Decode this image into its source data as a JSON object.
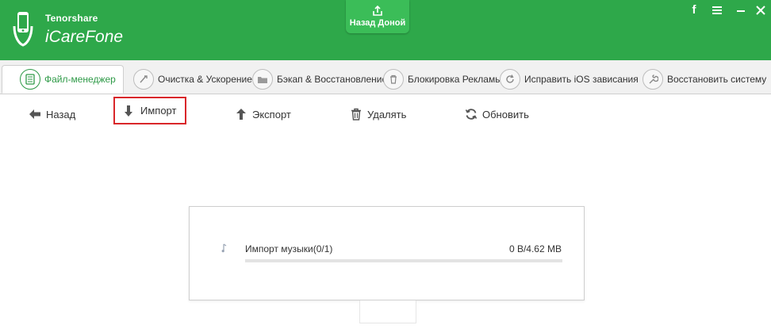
{
  "app": {
    "brand_small": "Tenorshare",
    "brand_name": "iCareFone",
    "home_button_label": "Назад Доной",
    "window_controls": [
      "facebook-icon",
      "menu-icon",
      "minimize-icon",
      "close-icon"
    ],
    "accent_color": "#2ea84a",
    "selected_outline_color": "#d9262a"
  },
  "tabs": [
    {
      "label": "Файл-менеджер",
      "icon": "file-manager-icon",
      "active": true
    },
    {
      "label": "Очистка & Ускорение",
      "icon": "rocket-icon",
      "active": false
    },
    {
      "label": "Бэкап & Восстановление",
      "icon": "folder-icon",
      "active": false
    },
    {
      "label": "Блокировка Рекламы",
      "icon": "trash-icon",
      "active": false
    },
    {
      "label": "Исправить iOS зависания",
      "icon": "refresh-icon",
      "active": false
    },
    {
      "label": "Восстановить систему",
      "icon": "wrench-icon",
      "active": false
    }
  ],
  "toolbar": {
    "back": "Назад",
    "import": "Импорт",
    "export": "Экспорт",
    "delete": "Удалять",
    "refresh": "Обновить"
  },
  "task": {
    "label": "Импорт музыки(0/1)",
    "size": "0 B/4.62 MB",
    "progress": 0
  }
}
